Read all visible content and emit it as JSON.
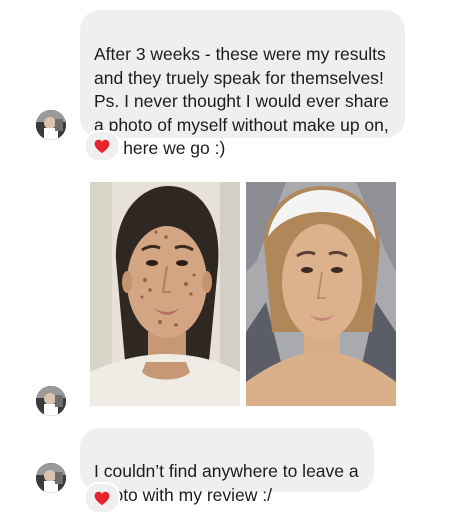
{
  "messages": [
    {
      "text": "After 3 weeks - these were my results\nand they truely speak for themselves!\nPs. I never thought I would ever share\na photo of myself without make up on,\nbut here we go :)",
      "reaction": "heart"
    },
    {
      "text": "I couldn’t find anywhere to leave a\nphoto with my review :/",
      "reaction": "heart"
    }
  ],
  "photos": [
    {
      "description": "before-photo"
    },
    {
      "description": "after-photo"
    }
  ],
  "icons": {
    "reaction": "heart-icon",
    "avatar": "user-avatar"
  },
  "colors": {
    "bubble_background": "#efeff0",
    "text": "#1c1c1e",
    "heart": "#e8232b"
  }
}
